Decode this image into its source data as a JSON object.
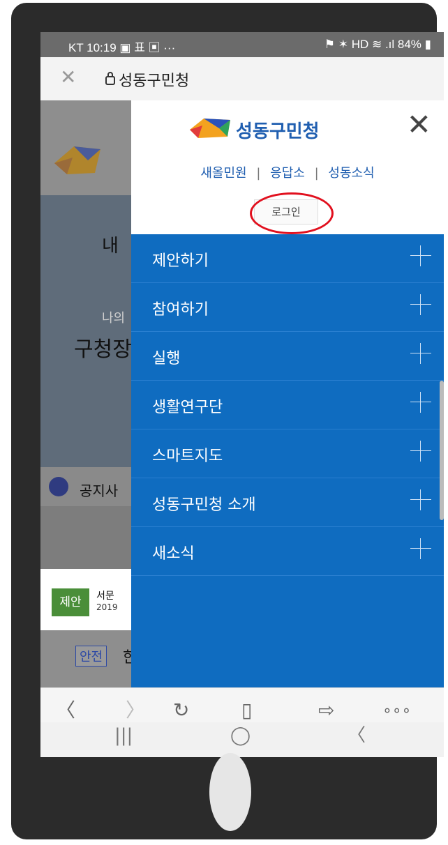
{
  "status_bar": {
    "left": "KT 10:19 ▣ 표 ▣ ···",
    "right": "⚑ ✶ HD ≋ .ıl 84% ▮"
  },
  "url_bar": {
    "close_icon": "close-icon",
    "lock_icon": "lock-icon",
    "title": "성동구민청"
  },
  "background_page": {
    "heading": "내",
    "sub": "나의",
    "line": "구청장",
    "notice_label": "공지사",
    "tag_proposal": "제안",
    "item_title": "서문",
    "item_date": "2019",
    "tag_safety": "안전",
    "item2_title": "한"
  },
  "drawer": {
    "brand": "성동구민청",
    "quick_links": [
      "새올민원",
      "응답소",
      "성동소식"
    ],
    "quick_sep": "|",
    "login_label": "로그인",
    "menu": [
      {
        "label": "제안하기"
      },
      {
        "label": "참여하기"
      },
      {
        "label": "실행"
      },
      {
        "label": "생활연구단"
      },
      {
        "label": "스마트지도"
      },
      {
        "label": "성동구민청 소개"
      },
      {
        "label": "새소식"
      }
    ],
    "colors": {
      "menu_bg": "#0f6cc0",
      "brand": "#1f5eb0",
      "highlight_circle": "#e1101e"
    }
  },
  "toolbar": {
    "back": "〈",
    "forward": "〉",
    "refresh": "↻",
    "bookmark": "▯",
    "share": "⇨",
    "more": "∘∘∘"
  },
  "navbar": {
    "recent": "|||",
    "home": "◯",
    "back": "〈"
  }
}
